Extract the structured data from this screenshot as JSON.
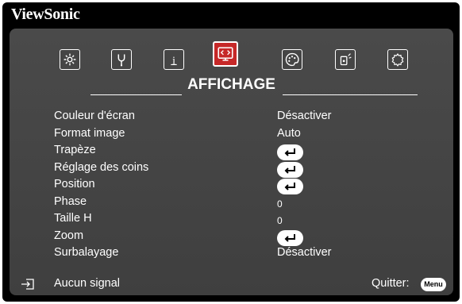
{
  "brand": "ViewSonic",
  "tabs": [
    {
      "icon": "picture-settings-icon",
      "active": false
    },
    {
      "icon": "advanced-settings-icon",
      "active": false
    },
    {
      "icon": "information-icon",
      "active": false
    },
    {
      "icon": "display-icon",
      "active": true
    },
    {
      "icon": "color-palette-icon",
      "active": false
    },
    {
      "icon": "audio-settings-icon",
      "active": false
    },
    {
      "icon": "system-settings-icon",
      "active": false
    }
  ],
  "tab_title": "AFFICHAGE",
  "items": [
    {
      "label": "Couleur d'écran",
      "value": "Désactiver"
    },
    {
      "label": "Format image",
      "value": "Auto"
    },
    {
      "label": "Trapèze",
      "value": "",
      "enter": true
    },
    {
      "label": "Réglage des coins",
      "value": "",
      "enter": true
    },
    {
      "label": "Position",
      "value": "",
      "enter": true
    },
    {
      "label": "Phase",
      "value": "0"
    },
    {
      "label": "Taille H",
      "value": "0"
    },
    {
      "label": "Zoom",
      "value": "",
      "enter": true
    },
    {
      "label": "Surbalayage",
      "value": "Désactiver"
    }
  ],
  "footer": {
    "source_status": "Aucun signal",
    "quit_label": "Quitter:",
    "menu_button": "Menu"
  },
  "colors": {
    "active_tab": "#c62828",
    "panel": "#444444",
    "frame": "#000000"
  }
}
